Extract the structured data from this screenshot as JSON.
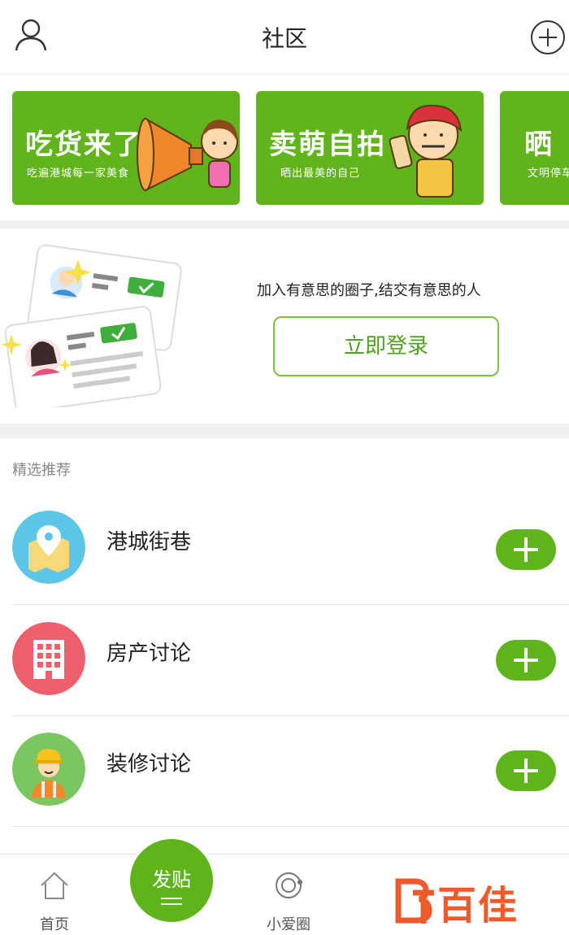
{
  "header": {
    "title": "社区"
  },
  "banners": [
    {
      "title": "吃货来了",
      "subtitle": "吃遍港城每一家美食"
    },
    {
      "title": "卖萌自拍",
      "subtitle": "晒出最美的自己"
    },
    {
      "title": "晒 ",
      "subtitle": "文明停车"
    }
  ],
  "promo": {
    "text": "加入有意思的圈子,结交有意思的人",
    "login_label": "立即登录"
  },
  "featured": {
    "title": "精选推荐",
    "items": [
      {
        "label": "港城街巷",
        "icon": "map-pin-icon",
        "color": "#5bc6e8"
      },
      {
        "label": "房产讨论",
        "icon": "building-icon",
        "color": "#ee5f6b"
      },
      {
        "label": "装修讨论",
        "icon": "worker-icon",
        "color": "#7cc660"
      }
    ]
  },
  "tabbar": {
    "items": [
      {
        "label": "首页",
        "icon": "home-icon"
      },
      {
        "label": "小爱圈",
        "icon": "circle-icon"
      },
      {
        "label": "",
        "icon": ""
      },
      {
        "label": "",
        "icon": ""
      }
    ],
    "post_label": "发贴"
  },
  "watermark": {
    "text": "百佳"
  },
  "colors": {
    "brand_green": "#5fb41c",
    "banner_green": "#61b41b",
    "watermark_orange": "#f05a2a"
  }
}
